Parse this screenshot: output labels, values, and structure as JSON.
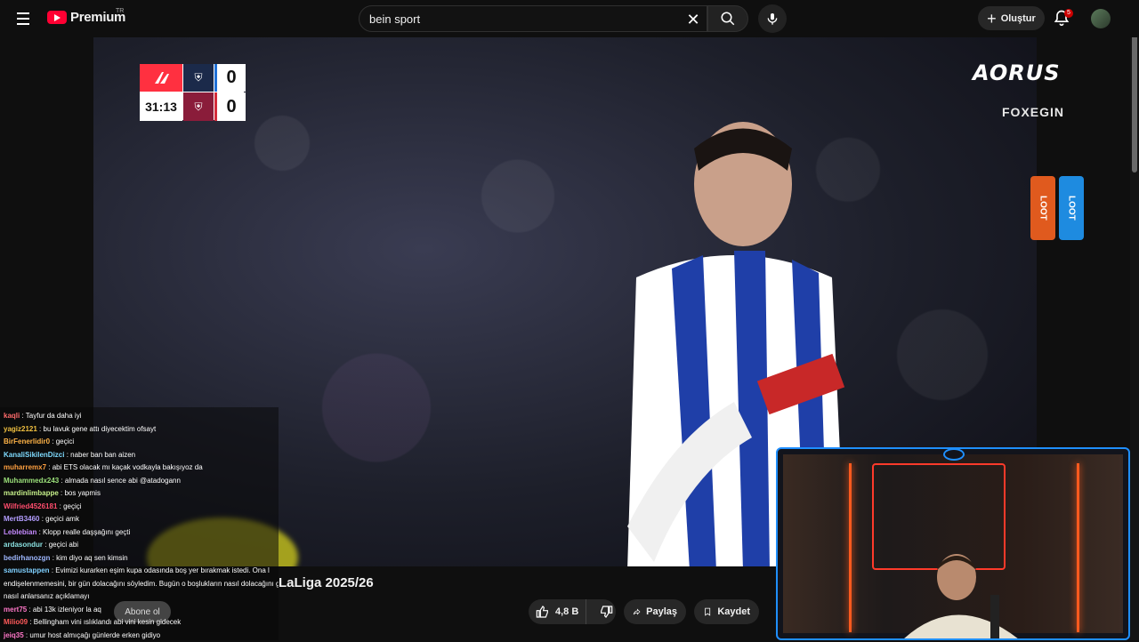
{
  "header": {
    "logo_text": "Premium",
    "logo_country": "TR",
    "search_value": "bein sport",
    "create_label": "Oluştur",
    "notification_count": "5"
  },
  "scoreboard": {
    "time": "31:13",
    "home_score": "0",
    "away_score": "0"
  },
  "sponsors": {
    "aorus": "AORUS",
    "foxegin": "FOXEGIN",
    "can_a": "LOOT",
    "can_b": "LOOT"
  },
  "video": {
    "title": "LaLiga 2025/26",
    "subscribe_label": "Abone ol",
    "likes": "4,8 B",
    "share_label": "Paylaş",
    "save_label": "Kaydet"
  },
  "chat": [
    {
      "user": "kaqli",
      "msg": ": Tayfur da daha iyi",
      "color": "#ff6b6b"
    },
    {
      "user": "yagiz2121",
      "msg": ": bu lavuk gene attı diyecektim ofsayt",
      "color": "#f0c040"
    },
    {
      "user": "BirFenerlidir0",
      "msg": ": geçici",
      "color": "#ffb347"
    },
    {
      "user": "KanaliSikilenDizci",
      "msg": ": naber ban ban aizen",
      "color": "#7fdbff"
    },
    {
      "user": "muharremx7",
      "msg": ": abi ETS olacak mı kaçak vodkayla bakışıyoz da",
      "color": "#ffa040"
    },
    {
      "user": "Muhammedx243",
      "msg": ": almada nasıl sence abi @atadogann",
      "color": "#9be07a"
    },
    {
      "user": "mardinlimbappe",
      "msg": ": bos yapmis",
      "color": "#c6f08a"
    },
    {
      "user": "Wilfried4526181",
      "msg": ": geçiçi",
      "color": "#ff4d6d"
    },
    {
      "user": "MertB3460",
      "msg": ": geçici amk",
      "color": "#b39dff"
    },
    {
      "user": "Leblebian",
      "msg": ": Klopp realle daşşağını geçti",
      "color": "#c58aff"
    },
    {
      "user": "ardasondur",
      "msg": ": geçici abi",
      "color": "#8ae0e0"
    },
    {
      "user": "bedirhanozgn",
      "msg": ": kim diyo aq sen kimsin",
      "color": "#9fb8ff"
    },
    {
      "user": "samustappen",
      "msg": ": Evimizi kurarken eşim kupa odasında boş yer bırakmak istedi. Ona l",
      "color": "#7fd0ff"
    },
    {
      "user": "",
      "msg": "endişelenmemesini, bir gün dolacağını söyledim. Bugün o boşlukların nasıl dolacağını görmesi",
      "color": "#ffffff"
    },
    {
      "user": "",
      "msg": "nasıl anlarsanız açıklamayı",
      "color": "#ffffff"
    },
    {
      "user": "mert75",
      "msg": ": abi 13k izleniyor la aq",
      "color": "#ff77c8"
    },
    {
      "user": "Milio09",
      "msg": ": Bellingham vini ıslıklandı abi vini kesin gidecek",
      "color": "#ff5a5a"
    },
    {
      "user": "jeiq35",
      "msg": ": umur host almıçağı günlerde erken gidiyo",
      "color": "#ff77c8"
    }
  ]
}
